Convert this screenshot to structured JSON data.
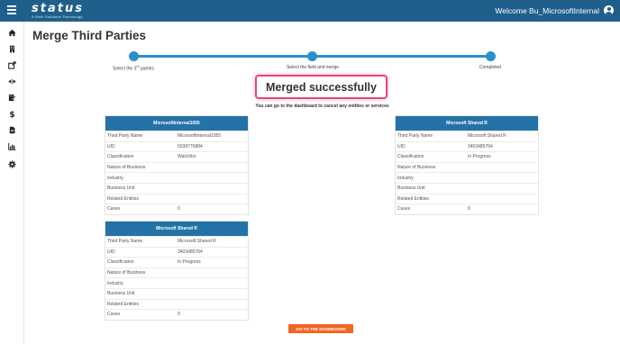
{
  "topbar": {
    "logo_text": "status",
    "logo_sub": "A Wolk Solutions Technology",
    "welcome": "Welcome Bu_MicrosoftInternal"
  },
  "sidebar": {
    "items": [
      {
        "name": "home-icon"
      },
      {
        "name": "building-icon"
      },
      {
        "name": "share-icon"
      },
      {
        "name": "eye-icon"
      },
      {
        "name": "edit-document-icon"
      },
      {
        "name": "dollar-icon"
      },
      {
        "name": "document-icon"
      },
      {
        "name": "bar-chart-icon"
      },
      {
        "name": "gear-icon"
      }
    ]
  },
  "page": {
    "title": "Merge Third Parties",
    "steps": [
      {
        "label": "Select the 3",
        "sup": "rd",
        "label_tail": " parties"
      },
      {
        "label": "Select the field and merge",
        "sup": "",
        "label_tail": ""
      },
      {
        "label": "Completed",
        "sup": "",
        "label_tail": ""
      }
    ],
    "success_message": "Merged successfully",
    "sub_message": "You can go to the dashboard to cancel any entities or services",
    "dashboard_button": "GO TO THE DASHBOARD"
  },
  "cards": [
    {
      "title": "MicrosoftInternal1055",
      "rows": [
        {
          "label": "Third Party Name",
          "value": "MicrosoftInternal1055"
        },
        {
          "label": "UID",
          "value": "5038776884"
        },
        {
          "label": "Classification",
          "value": "Watchlist"
        },
        {
          "label": "Nature of Business",
          "value": ""
        },
        {
          "label": "Industry",
          "value": ""
        },
        {
          "label": "Business Unit",
          "value": ""
        },
        {
          "label": "Related Entities",
          "value": ""
        },
        {
          "label": "Cases",
          "value": "0"
        }
      ]
    },
    {
      "title": "Microsoft Shared R",
      "rows": [
        {
          "label": "Third Party Name",
          "value": "Microsoft Shared R"
        },
        {
          "label": "UID",
          "value": "3403485764"
        },
        {
          "label": "Classification",
          "value": "In Progress"
        },
        {
          "label": "Nature of Business",
          "value": ""
        },
        {
          "label": "Industry",
          "value": ""
        },
        {
          "label": "Business Unit",
          "value": ""
        },
        {
          "label": "Related Entities",
          "value": ""
        },
        {
          "label": "Cases",
          "value": "0"
        }
      ]
    },
    {
      "title": "Microsoft Shared R",
      "rows": [
        {
          "label": "Third Party Name",
          "value": "Microsoft Shared R"
        },
        {
          "label": "UID",
          "value": "3403485764"
        },
        {
          "label": "Classification",
          "value": "In Progress"
        },
        {
          "label": "Nature of Business",
          "value": ""
        },
        {
          "label": "Industry",
          "value": ""
        },
        {
          "label": "Business Unit",
          "value": ""
        },
        {
          "label": "Related Entities",
          "value": ""
        },
        {
          "label": "Cases",
          "value": "0"
        }
      ]
    }
  ]
}
